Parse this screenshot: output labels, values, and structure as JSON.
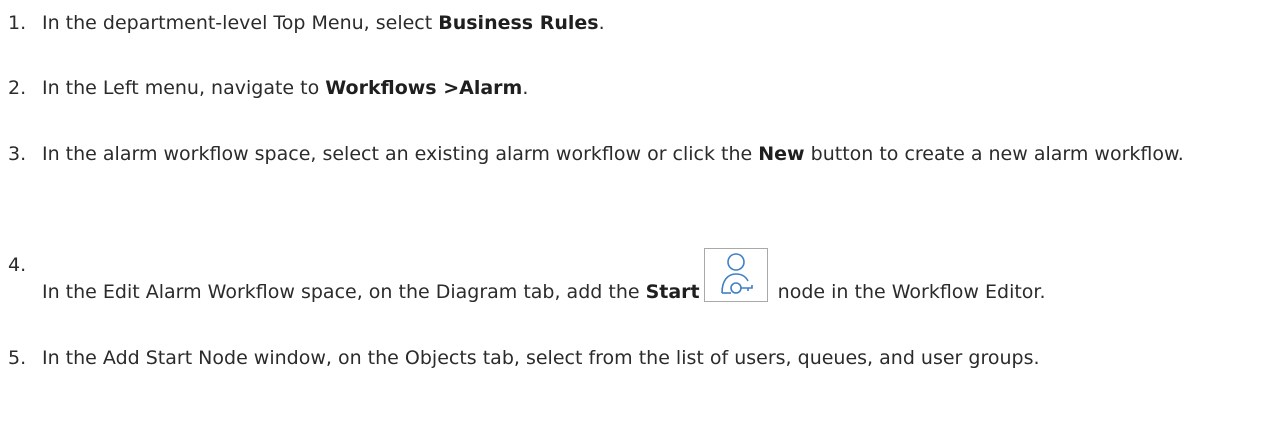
{
  "steps": [
    {
      "number": "1.",
      "pre": "In the department-level Top Menu, select ",
      "bold": "Business Rules",
      "post": "."
    },
    {
      "number": "2.",
      "pre": "In the Left menu, navigate to ",
      "bold": "Workflows >Alarm",
      "post": "."
    },
    {
      "number": "3.",
      "pre": "In the alarm workflow space, select an existing alarm workflow or click the ",
      "bold": "New",
      "post": " button to create a new alarm workflow."
    },
    {
      "number": "4.",
      "pre": "In the Edit Alarm Workflow space, on the Diagram tab, add the ",
      "bold": "Start",
      "icon": "start-node-icon",
      "post": " node in the Workflow Editor."
    },
    {
      "number": "5.",
      "text": "In the Add Start Node window, on the Objects tab, select from the list of users, queues, and user groups."
    }
  ],
  "colors": {
    "text": "#2b2b2b",
    "icon_stroke": "#3f7fc6",
    "icon_border": "#a9a9a9"
  }
}
